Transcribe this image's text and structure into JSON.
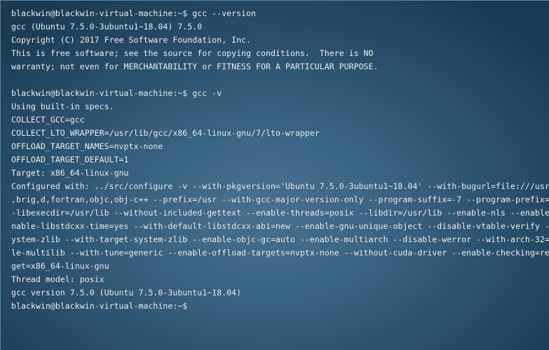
{
  "terminal": {
    "lines": [
      "blackwin@blackwin-virtual-machine:~$ gcc --version",
      "gcc (Ubuntu 7.5.0-3ubuntu1~18.04) 7.5.0",
      "Copyright (C) 2017 Free Software Foundation, Inc.",
      "This is free software; see the source for copying conditions.  There is NO",
      "warranty; not even for MERCHANTABILITY or FITNESS FOR A PARTICULAR PURPOSE.",
      "",
      "blackwin@blackwin-virtual-machine:~$ gcc -v",
      "Using built-in specs.",
      "COLLECT_GCC=gcc",
      "COLLECT_LTO_WRAPPER=/usr/lib/gcc/x86_64-linux-gnu/7/lto-wrapper",
      "OFFLOAD_TARGET_NAMES=nvptx-none",
      "OFFLOAD_TARGET_DEFAULT=1",
      "Target: x86_64-linux-gnu",
      "Configured with: ../src/configure -v --with-pkgversion='Ubuntu 7.5.0-3ubuntu1~18.04' --with-bugurl=file:///usr",
      ",brig,d,fortran,objc,obj-c++ --prefix=/usr --with-gcc-major-version-only --program-suffix=-7 --program-prefix=",
      "-libexecdir=/usr/lib --without-included-gettext --enable-threads=posix --libdir=/usr/lib --enable-nls --enable",
      "nable-libstdcxx-time=yes --with-default-libstdcxx-abi=new --enable-gnu-unique-object --disable-vtable-verify -",
      "ystem-zlib --with-target-system-zlib --enable-objc-gc=auto --enable-multiarch --disable-werror --with-arch-32=",
      "le-multilib --with-tune=generic --enable-offload-targets=nvptx-none --without-cuda-driver --enable-checking=re",
      "get=x86_64-linux-gnu",
      "Thread model: posix",
      "gcc version 7.5.0 (Ubuntu 7.5.0-3ubuntu1~18.04)",
      "blackwin@blackwin-virtual-machine:~$ "
    ]
  },
  "colors": {
    "text": "#eef2f5",
    "background": "#3a6582"
  }
}
